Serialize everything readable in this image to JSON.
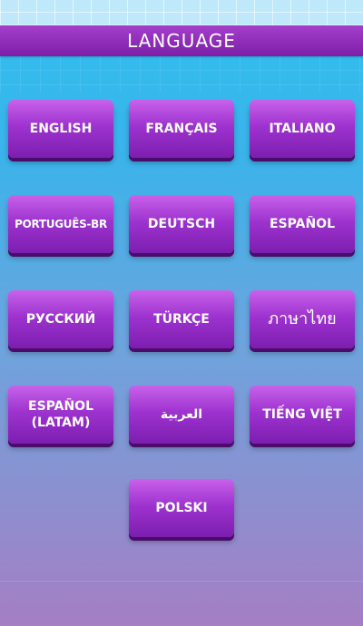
{
  "header": {
    "title": "LANGUAGE"
  },
  "languages": [
    {
      "label": "ENGLISH"
    },
    {
      "label": "FRANÇAIS"
    },
    {
      "label": "ITALIANO"
    },
    {
      "label": "PORTUGUÊS-BR"
    },
    {
      "label": "DEUTSCH"
    },
    {
      "label": "ESPAÑOL"
    },
    {
      "label": "РУССКИЙ"
    },
    {
      "label": "TÜRKÇE"
    },
    {
      "label": "ภาษาไทย"
    },
    {
      "label": "ESPAÑOL\n(LATAM)"
    },
    {
      "label": "العربية"
    },
    {
      "label": "TIẾNG VIỆT"
    },
    {
      "label": "POLSKI"
    }
  ],
  "colors": {
    "header_bar": "#8b2bb8",
    "button_top": "#c862ea",
    "button_bottom": "#7c1eb0",
    "button_shadow": "#4a0c6b",
    "background_top": "#2fc0ef",
    "background_bottom": "#a57ec4"
  }
}
